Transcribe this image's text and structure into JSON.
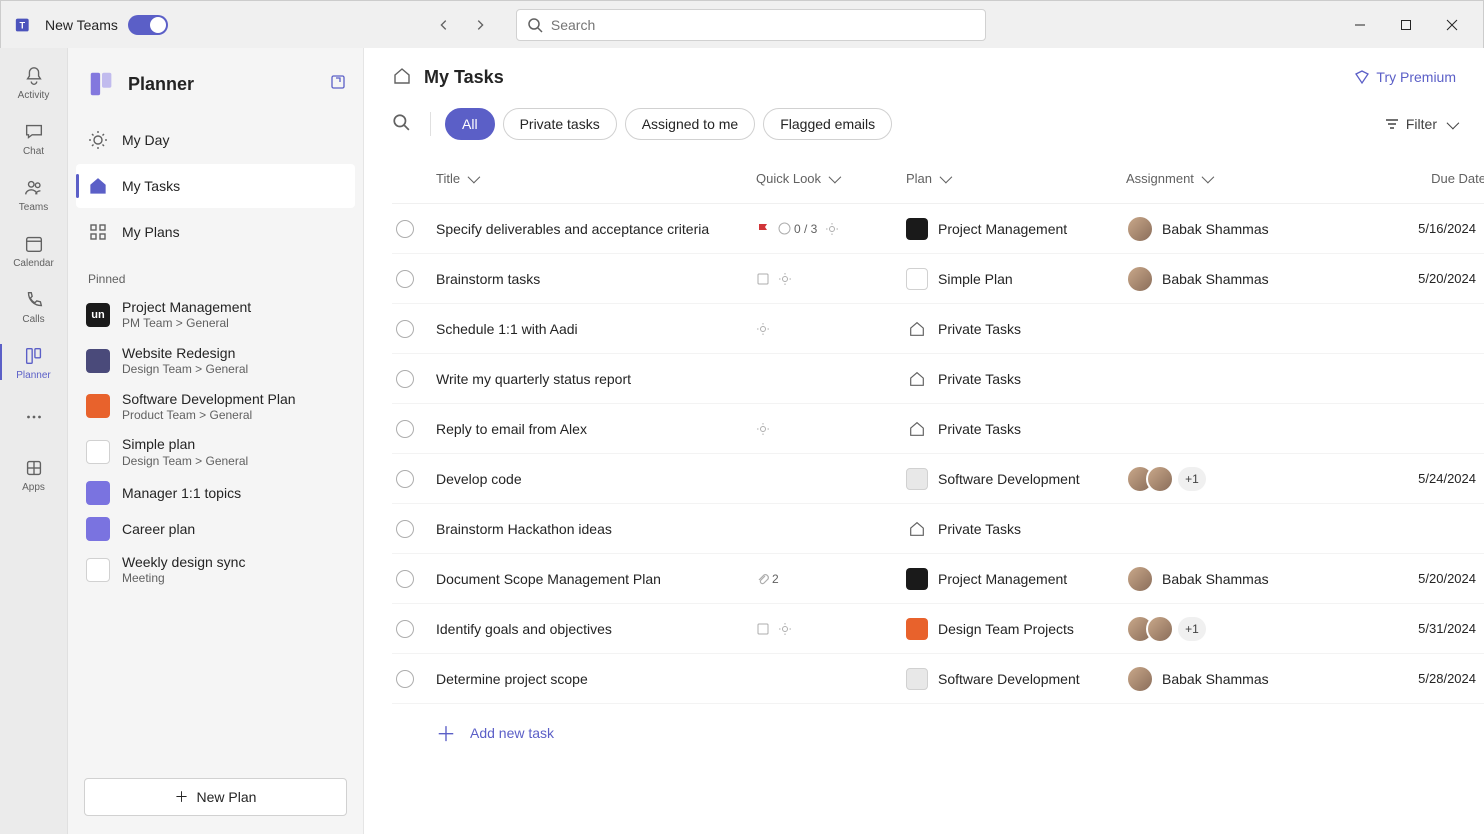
{
  "titlebar": {
    "new_teams_label": "New Teams",
    "search_placeholder": "Search"
  },
  "rail": {
    "items": [
      {
        "label": "Activity",
        "icon": "bell"
      },
      {
        "label": "Chat",
        "icon": "chat"
      },
      {
        "label": "Teams",
        "icon": "people"
      },
      {
        "label": "Calendar",
        "icon": "calendar"
      },
      {
        "label": "Calls",
        "icon": "phone"
      },
      {
        "label": "Planner",
        "icon": "planner",
        "active": true
      },
      {
        "label": "",
        "icon": "more"
      },
      {
        "label": "Apps",
        "icon": "apps"
      }
    ]
  },
  "sidebar": {
    "title": "Planner",
    "nav": [
      {
        "label": "My Day",
        "icon": "sun"
      },
      {
        "label": "My Tasks",
        "icon": "home",
        "active": true
      },
      {
        "label": "My Plans",
        "icon": "grid"
      }
    ],
    "pinned_label": "Pinned",
    "pinned": [
      {
        "name": "Project Management",
        "sub": "PM Team > General",
        "color": "#1a1a1a",
        "initial": "un"
      },
      {
        "name": "Website Redesign",
        "sub": "Design Team > General",
        "color": "#4a4a7a",
        "initial": ""
      },
      {
        "name": "Software Development Plan",
        "sub": "Product Team > General",
        "color": "#e8622c",
        "initial": ""
      },
      {
        "name": "Simple plan",
        "sub": "Design Team > General",
        "color": "#ffffff",
        "initial": ""
      },
      {
        "name": "Manager 1:1 topics",
        "sub": "",
        "color": "#7a73e0",
        "initial": ""
      },
      {
        "name": "Career plan",
        "sub": "",
        "color": "#7a73e0",
        "initial": ""
      },
      {
        "name": "Weekly design sync",
        "sub": "Meeting",
        "color": "#ffffff",
        "initial": ""
      }
    ],
    "new_plan_label": "New Plan"
  },
  "main": {
    "title": "My Tasks",
    "premium_label": "Try Premium",
    "chips": [
      "All",
      "Private tasks",
      "Assigned to me",
      "Flagged emails"
    ],
    "active_chip": 0,
    "filter_label": "Filter",
    "columns": [
      "Title",
      "Quick Look",
      "Plan",
      "Assignment",
      "Due Date"
    ],
    "add_task_label": "Add new task",
    "rows": [
      {
        "title": "Specify deliverables and acceptance criteria",
        "quick": {
          "flag": true,
          "progress": "0 / 3",
          "sun": true
        },
        "plan": "Project Management",
        "plan_color": "#1a1a1a",
        "assign": {
          "type": "single",
          "name": "Babak Shammas"
        },
        "due": "5/16/2024"
      },
      {
        "title": "Brainstorm tasks",
        "quick": {
          "note": true,
          "sun": true
        },
        "plan": "Simple Plan",
        "plan_color": "#ffffff",
        "assign": {
          "type": "single",
          "name": "Babak Shammas"
        },
        "due": "5/20/2024"
      },
      {
        "title": "Schedule 1:1 with Aadi",
        "quick": {
          "sun": true
        },
        "plan": "Private Tasks",
        "plan_color": "private",
        "assign": {
          "type": "none"
        },
        "due": ""
      },
      {
        "title": "Write my quarterly status report",
        "quick": {},
        "plan": "Private Tasks",
        "plan_color": "private",
        "assign": {
          "type": "none"
        },
        "due": ""
      },
      {
        "title": "Reply to email from Alex",
        "quick": {
          "sun": true
        },
        "plan": "Private Tasks",
        "plan_color": "private",
        "assign": {
          "type": "none"
        },
        "due": ""
      },
      {
        "title": "Develop code",
        "quick": {},
        "plan": "Software Development",
        "plan_color": "#e8e8e8",
        "assign": {
          "type": "multi",
          "extra": "+1"
        },
        "due": "5/24/2024"
      },
      {
        "title": "Brainstorm Hackathon ideas",
        "quick": {},
        "plan": "Private Tasks",
        "plan_color": "private",
        "assign": {
          "type": "none"
        },
        "due": ""
      },
      {
        "title": "Document Scope Management Plan",
        "quick": {
          "attach": "2"
        },
        "plan": "Project Management",
        "plan_color": "#1a1a1a",
        "assign": {
          "type": "single",
          "name": "Babak Shammas"
        },
        "due": "5/20/2024"
      },
      {
        "title": "Identify goals and objectives",
        "quick": {
          "note": true,
          "sun": true
        },
        "plan": "Design Team Projects",
        "plan_color": "#e8622c",
        "assign": {
          "type": "multi",
          "extra": "+1"
        },
        "due": "5/31/2024"
      },
      {
        "title": "Determine project scope",
        "quick": {},
        "plan": "Software Development",
        "plan_color": "#e8e8e8",
        "assign": {
          "type": "single",
          "name": "Babak Shammas"
        },
        "due": "5/28/2024"
      }
    ]
  }
}
